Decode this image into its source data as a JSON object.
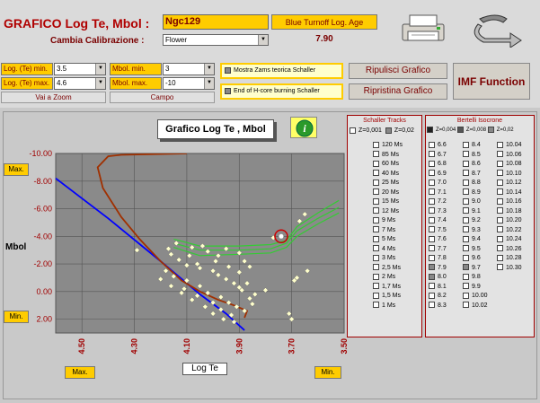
{
  "header": {
    "title": "GRAFICO Log Te, Mbol :",
    "star_name": "Ngc129",
    "blue_turnoff_label": "Blue Turnoff Log. Age",
    "calib_label": "Cambia Calibrazione :",
    "calib_value": "Flower",
    "age_value": "7.90"
  },
  "axes_form": {
    "logte_min_label": "Log. (Te) min.",
    "logte_min_value": "3.5",
    "logte_max_label": "Log. (Te) max.",
    "logte_max_value": "4.6",
    "zoom_caption": "Vai a Zoom",
    "mbol_min_label": "Mbol. min.",
    "mbol_min_value": "3",
    "mbol_max_label": "Mbol. max.",
    "mbol_max_value": "-10",
    "field_caption": "Campo"
  },
  "options": {
    "zams_label": "Mostra Zams teorica Schaller",
    "hcore_label": "End of H-core burning Schaller"
  },
  "buttons": {
    "clear": "Ripulisci Grafico",
    "restore": "Ripristina Grafico",
    "imf": "IMF Function"
  },
  "chart_title": "Grafico Log Te , Mbol",
  "axis_labels": {
    "x_title": "Log Te",
    "y_title": "Mbol",
    "max_y": "Max.",
    "min_y": "Min.",
    "max_x": "Max.",
    "min_x": "Min."
  },
  "tracks_panel": {
    "title": "Schaller Tracks",
    "z1": "Z=0,001",
    "z2": "Z=0,02",
    "items": [
      "120 Ms",
      "85 Ms",
      "60 Ms",
      "40 Ms",
      "25 Ms",
      "20 Ms",
      "15 Ms",
      "12 Ms",
      "9 Ms",
      "7 Ms",
      "5 Ms",
      "4 Ms",
      "3 Ms",
      "2,5 Ms",
      "2 Ms",
      "1,7 Ms",
      "1,5 Ms",
      "1 Ms"
    ]
  },
  "iso_panel": {
    "title": "Bertelli Isocrone",
    "z1": "Z=0,004",
    "z2": "Z=0,008",
    "z3": "Z=0,02",
    "col1": [
      "6.6",
      "6.7",
      "6.8",
      "6.9",
      "7.0",
      "7.1",
      "7.2",
      "7.3",
      "7.4",
      "7.5",
      "7.6",
      "7.7",
      "7.8",
      "7.9",
      "8.0",
      "8.1",
      "8.2",
      "8.3"
    ],
    "col2": [
      "8.4",
      "8.5",
      "8.6",
      "8.7",
      "8.8",
      "8.9",
      "9.0",
      "9.1",
      "9.2",
      "9.3",
      "9.4",
      "9.5",
      "9.6",
      "9.7",
      "9.8",
      "9.9",
      "10.00",
      "10.02"
    ],
    "col3": [
      "10.04",
      "10.06",
      "10.08",
      "10.10",
      "10.12",
      "10.14",
      "10.16",
      "10.18",
      "10.20",
      "10.22",
      "10.24",
      "10.26",
      "10.28",
      "10.30"
    ]
  },
  "chart_data": {
    "type": "scatter",
    "title": "Grafico Log Te , Mbol",
    "xlabel": "Log Te",
    "ylabel": "Mbol",
    "xlim": [
      4.6,
      3.5
    ],
    "ylim": [
      3,
      -10
    ],
    "x_ticks": [
      "4.50",
      "4.30",
      "4.10",
      "3.90",
      "3.70",
      "3.50"
    ],
    "y_ticks": [
      "-10.00",
      "-8.00",
      "-6.00",
      "-4.00",
      "-2.00",
      "0.00",
      "2.00"
    ],
    "colors": {
      "zams": "#0000ff",
      "track": "#a03000",
      "isochrone": "#33cc33",
      "points": "#ffffcc",
      "highlight": "#cc0000"
    },
    "zams": [
      [
        4.6,
        -8.2
      ],
      [
        4.4,
        -5.3
      ],
      [
        4.2,
        -2.2
      ],
      [
        4.05,
        0.2
      ],
      [
        3.95,
        1.6
      ],
      [
        3.88,
        2.8
      ]
    ],
    "track": [
      [
        3.88,
        1.9
      ],
      [
        3.87,
        1.4
      ],
      [
        3.92,
        1.0
      ],
      [
        3.98,
        0.6
      ],
      [
        4.05,
        0.0
      ],
      [
        4.12,
        -0.8
      ],
      [
        4.2,
        -2.2
      ],
      [
        4.28,
        -3.8
      ],
      [
        4.35,
        -5.4
      ],
      [
        4.42,
        -7.5
      ],
      [
        4.44,
        -9.0
      ],
      [
        4.4,
        -9.8
      ],
      [
        4.35,
        -9.9
      ],
      [
        4.1,
        -10.0
      ]
    ],
    "iso1": [
      [
        4.15,
        -3.5
      ],
      [
        4.05,
        -3.0
      ],
      [
        3.9,
        -3.0
      ],
      [
        3.78,
        -3.1
      ],
      [
        3.72,
        -3.5
      ],
      [
        3.68,
        -4.4
      ],
      [
        3.6,
        -5.3
      ],
      [
        3.52,
        -6.1
      ]
    ],
    "iso2": [
      [
        4.15,
        -3.2
      ],
      [
        4.05,
        -2.6
      ],
      [
        3.9,
        -2.7
      ],
      [
        3.78,
        -2.8
      ],
      [
        3.72,
        -3.2
      ],
      [
        3.68,
        -4.0
      ],
      [
        3.6,
        -4.9
      ],
      [
        3.52,
        -5.7
      ]
    ],
    "iso3": [
      [
        4.15,
        -3.8
      ],
      [
        4.05,
        -3.3
      ],
      [
        3.9,
        -3.3
      ],
      [
        3.78,
        -3.4
      ],
      [
        3.72,
        -3.7
      ],
      [
        3.68,
        -4.7
      ],
      [
        3.6,
        -5.7
      ],
      [
        3.52,
        -6.6
      ]
    ],
    "points": [
      [
        4.29,
        -3.0
      ],
      [
        4.16,
        -2.7
      ],
      [
        4.13,
        -2.3
      ],
      [
        4.1,
        -1.9
      ],
      [
        4.05,
        -1.7
      ],
      [
        4.0,
        -1.5
      ],
      [
        3.98,
        -1.2
      ],
      [
        3.95,
        -0.9
      ],
      [
        3.92,
        -0.6
      ],
      [
        3.9,
        -0.3
      ],
      [
        4.18,
        -1.5
      ],
      [
        4.15,
        -1.1
      ],
      [
        4.1,
        -0.8
      ],
      [
        4.05,
        -0.4
      ],
      [
        4.02,
        0.1
      ],
      [
        3.97,
        0.4
      ],
      [
        3.94,
        0.8
      ],
      [
        3.91,
        1.1
      ],
      [
        3.88,
        1.4
      ],
      [
        3.85,
        0.9
      ],
      [
        4.2,
        -0.9
      ],
      [
        4.16,
        -0.4
      ],
      [
        4.12,
        0.1
      ],
      [
        4.08,
        0.6
      ],
      [
        4.03,
        1.1
      ],
      [
        4.0,
        1.6
      ],
      [
        3.96,
        2.0
      ],
      [
        3.92,
        2.2
      ],
      [
        4.17,
        -3.1
      ],
      [
        4.14,
        -3.5
      ],
      [
        4.08,
        -3.2
      ],
      [
        4.02,
        -2.9
      ],
      [
        3.95,
        -3.1
      ],
      [
        3.9,
        -2.8
      ],
      [
        3.88,
        -2.2
      ],
      [
        3.86,
        -1.8
      ],
      [
        4.06,
        -2.0
      ],
      [
        3.99,
        -2.2
      ],
      [
        3.94,
        -1.8
      ],
      [
        3.9,
        -1.4
      ],
      [
        3.87,
        -0.6
      ],
      [
        3.84,
        0.2
      ],
      [
        3.8,
        -0.1
      ],
      [
        3.77,
        -3.9
      ],
      [
        3.74,
        -4.0
      ],
      [
        3.67,
        -5.1
      ],
      [
        3.65,
        -5.6
      ],
      [
        3.64,
        -1.5
      ],
      [
        3.69,
        -0.8
      ],
      [
        3.68,
        -1.0
      ],
      [
        3.7,
        2.0
      ],
      [
        3.71,
        1.6
      ],
      [
        4.11,
        -0.2
      ],
      [
        4.06,
        0.3
      ],
      [
        4.0,
        0.8
      ],
      [
        3.97,
        1.3
      ],
      [
        3.93,
        1.7
      ],
      [
        3.89,
        -0.1
      ],
      [
        3.86,
        0.5
      ],
      [
        4.09,
        -2.6
      ],
      [
        4.04,
        -3.3
      ],
      [
        3.98,
        -2.6
      ]
    ],
    "highlight": [
      3.74,
      -4.0
    ]
  }
}
